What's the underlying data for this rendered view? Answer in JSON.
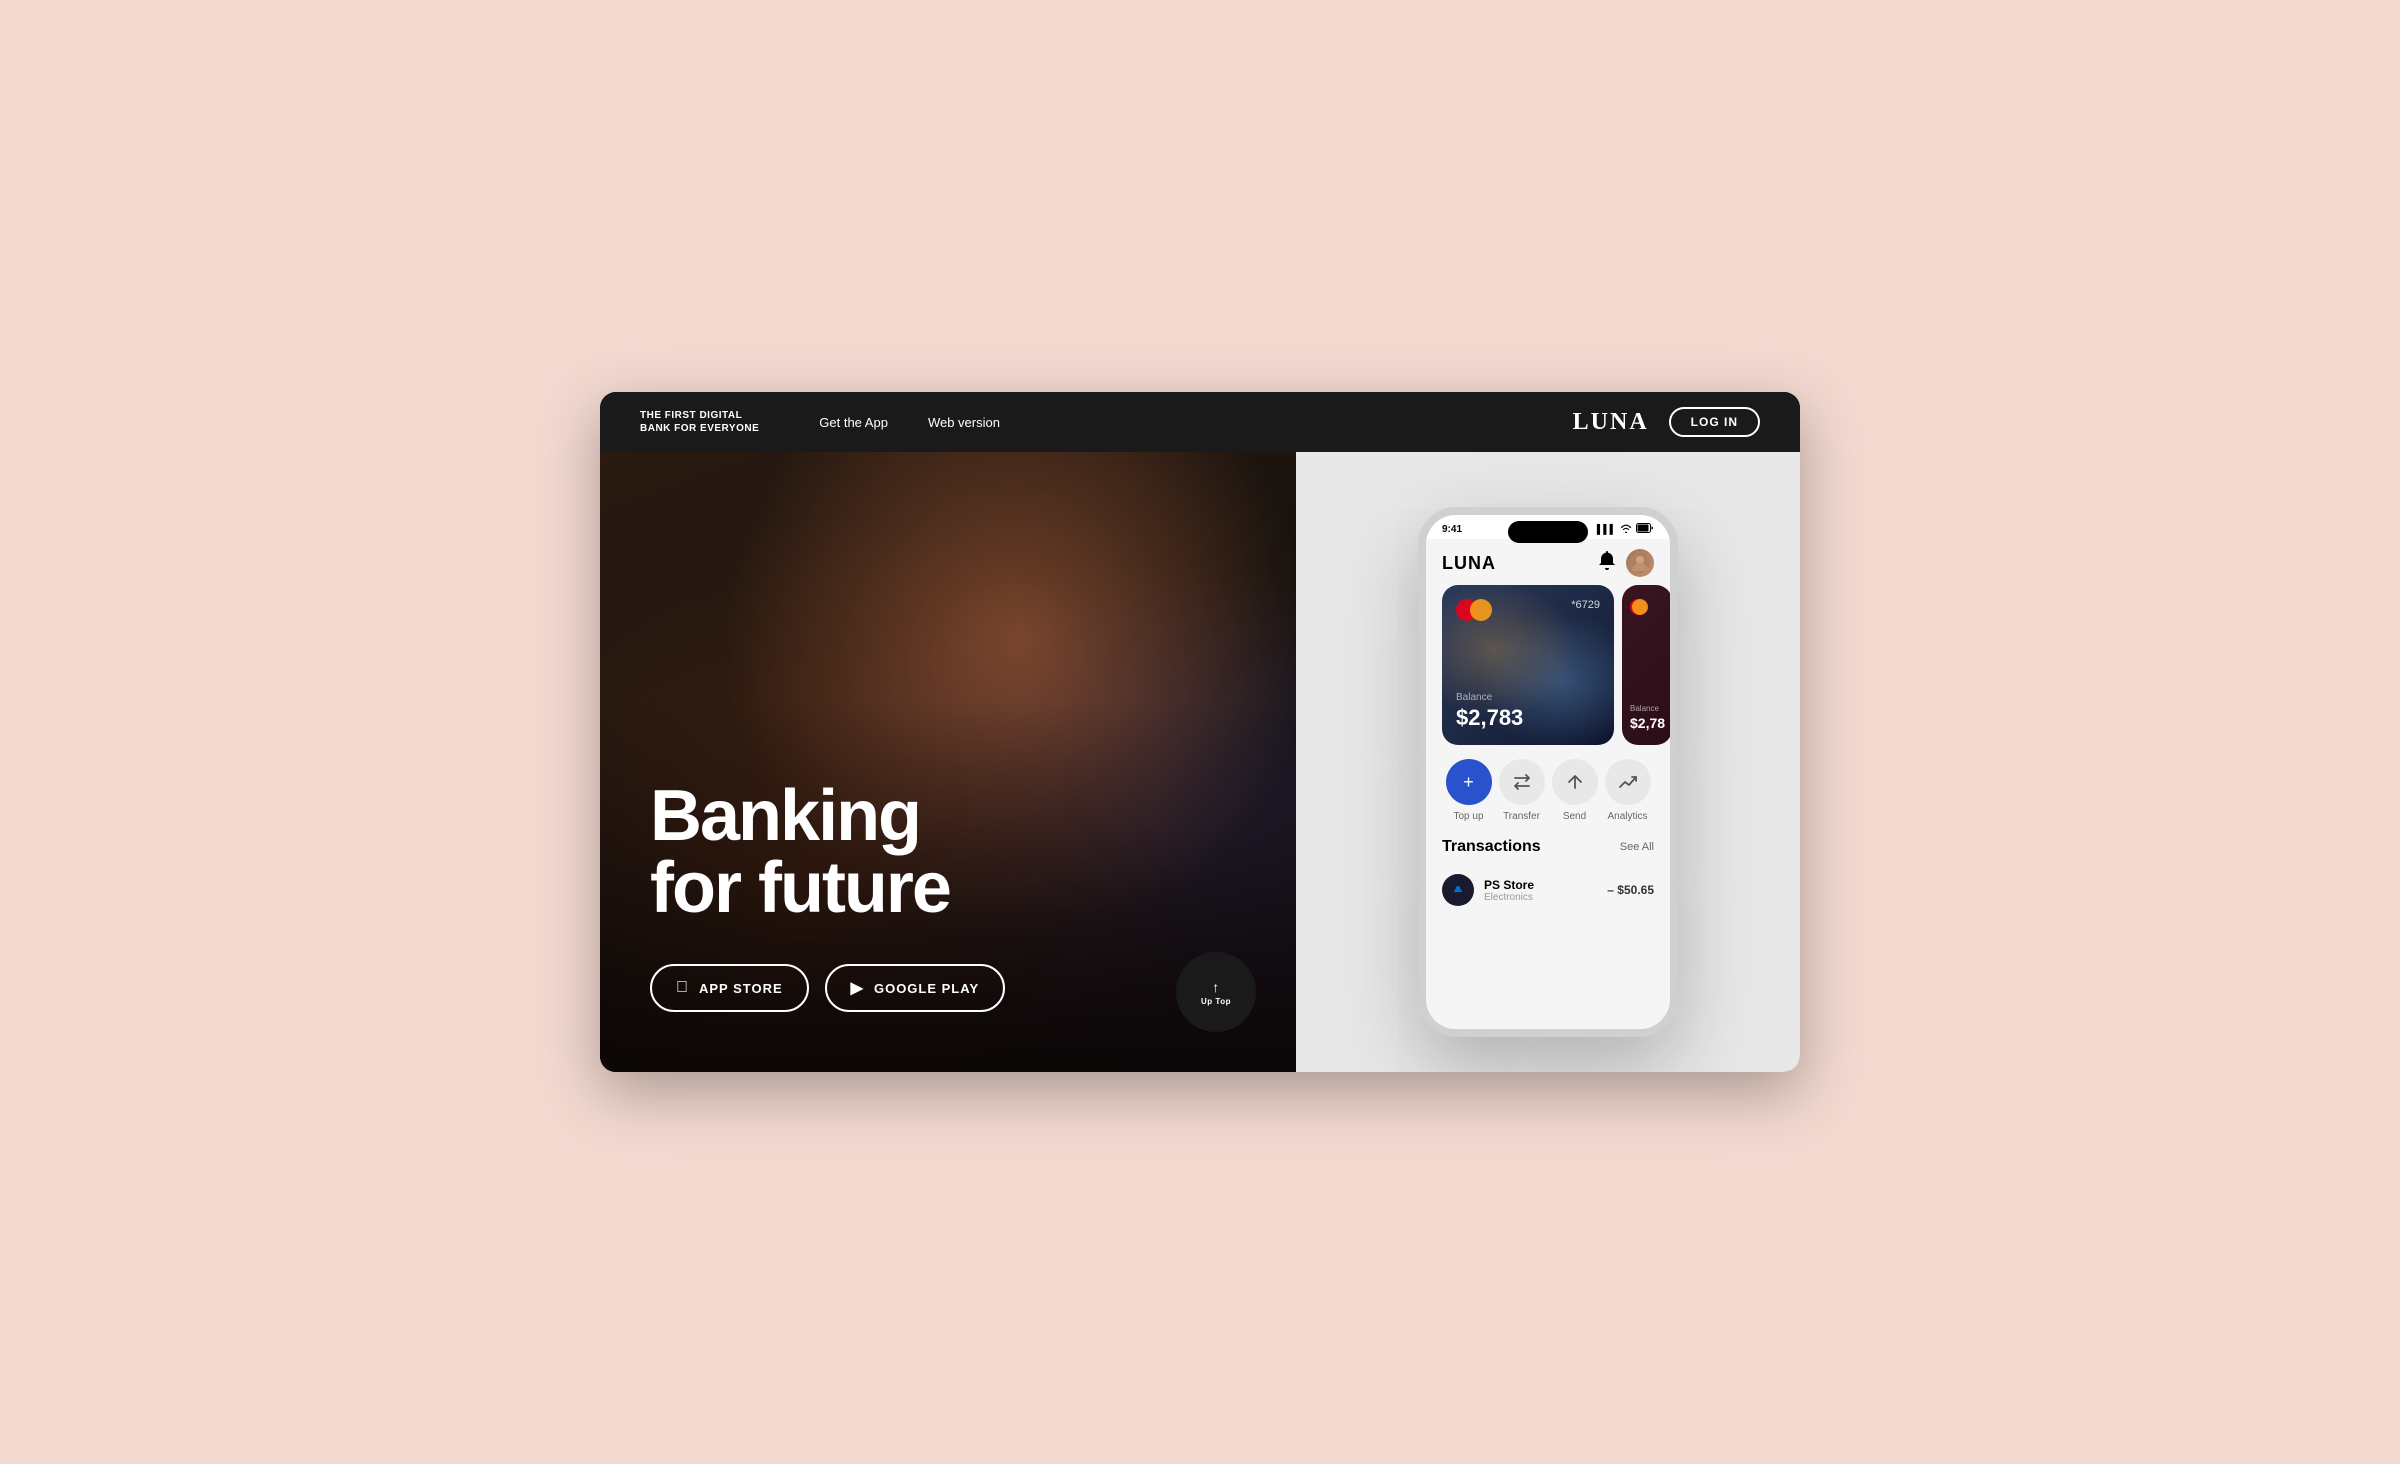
{
  "page": {
    "background": "#f2d9d0"
  },
  "navbar": {
    "tagline": "THE FIRST DIGITAL\nBANK FOR EVERYONE",
    "links": [
      {
        "label": "Get the App",
        "id": "get-app"
      },
      {
        "label": "Web version",
        "id": "web-version"
      }
    ],
    "brand": "LUNA",
    "login_label": "LOG IN"
  },
  "hero": {
    "title_line1": "Banking",
    "title_line2": "for future",
    "store_buttons": [
      {
        "label": "APP STORE",
        "id": "app-store",
        "icon": ""
      },
      {
        "label": "GOOGLE PLAY",
        "id": "google-play",
        "icon": "▶"
      }
    ]
  },
  "phone": {
    "status": {
      "time": "9:41",
      "signal": "▌▌▌",
      "wifi": "wifi",
      "battery": "🔋"
    },
    "app": {
      "logo": "LUNA",
      "cards": [
        {
          "number": "*6729",
          "balance_label": "Balance",
          "balance": "$2,783"
        },
        {
          "balance_label": "Balance",
          "balance": "$2,78"
        }
      ],
      "actions": [
        {
          "label": "Top up",
          "icon": "+",
          "primary": true
        },
        {
          "label": "Transfer",
          "icon": "⇄",
          "primary": false
        },
        {
          "label": "Send",
          "icon": "↑",
          "primary": false
        },
        {
          "label": "Analytics",
          "icon": "↗",
          "primary": false
        }
      ],
      "transactions_title": "Transactions",
      "see_all": "See All",
      "transactions": [
        {
          "name": "PS Store",
          "category": "Electronics",
          "amount": "– $50.65",
          "icon": "🎮"
        }
      ]
    }
  },
  "up_top": {
    "label": "Up Top",
    "arrow": "↑"
  }
}
